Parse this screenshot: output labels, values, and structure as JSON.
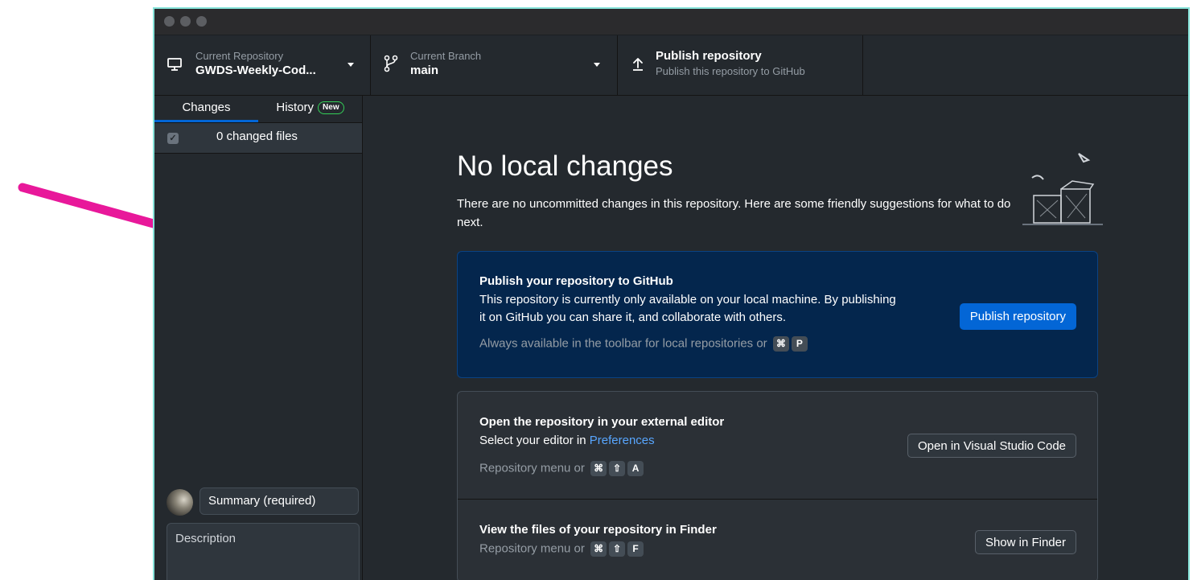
{
  "colors": {
    "accent": "#0366d6",
    "arrow": "#e8189a",
    "window_border": "#86e3d9",
    "new_badge": "#34d058"
  },
  "toolbar": {
    "repo": {
      "label": "Current Repository",
      "value": "GWDS-Weekly-Cod...",
      "icon": "monitor-icon"
    },
    "branch": {
      "label": "Current Branch",
      "value": "main",
      "icon": "git-branch-icon"
    },
    "publish": {
      "label": "Publish repository",
      "sub": "Publish this repository to GitHub",
      "icon": "upload-icon"
    }
  },
  "sidebar": {
    "tabs": [
      {
        "label": "Changes",
        "active": true
      },
      {
        "label": "History",
        "badge": "New"
      }
    ],
    "changed_files": "0 changed files",
    "summary_placeholder": "Summary (required)",
    "description_placeholder": "Description"
  },
  "main": {
    "heading": "No local changes",
    "intro": "There are no uncommitted changes in this repository. Here are some friendly suggestions for what to do next.",
    "publish_card": {
      "title": "Publish your repository to GitHub",
      "text": "This repository is currently only available on your local machine. By publishing it on GitHub you can share it, and collaborate with others.",
      "hint": "Always available in the toolbar for local repositories or",
      "keys": [
        "⌘",
        "P"
      ],
      "button": "Publish repository"
    },
    "editor_card": {
      "title": "Open the repository in your external editor",
      "text": "Select your editor in",
      "link": "Preferences",
      "hint": "Repository menu or",
      "keys": [
        "⌘",
        "⇧",
        "A"
      ],
      "button": "Open in Visual Studio Code"
    },
    "finder_card": {
      "title": "View the files of your repository in Finder",
      "hint": "Repository menu or",
      "keys": [
        "⌘",
        "⇧",
        "F"
      ],
      "button": "Show in Finder"
    }
  }
}
